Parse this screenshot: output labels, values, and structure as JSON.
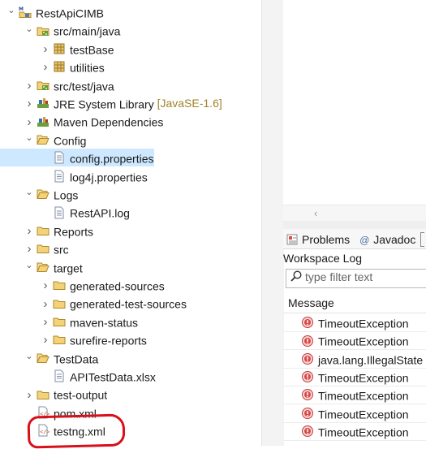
{
  "tree": [
    {
      "label": "RestApiCIMB",
      "twisty": "open",
      "icon": "maven-project-icon",
      "indent": 0
    },
    {
      "label": "src/main/java",
      "twisty": "open",
      "icon": "source-folder-icon",
      "indent": 1
    },
    {
      "label": "testBase",
      "twisty": "closed",
      "icon": "package-icon",
      "indent": 2
    },
    {
      "label": "utilities",
      "twisty": "closed",
      "icon": "package-icon",
      "indent": 2
    },
    {
      "label": "src/test/java",
      "twisty": "closed",
      "icon": "source-folder-icon",
      "indent": 1
    },
    {
      "label": "JRE System Library",
      "decoration": "[JavaSE-1.6]",
      "twisty": "closed",
      "icon": "library-icon",
      "indent": 1
    },
    {
      "label": "Maven Dependencies",
      "twisty": "closed",
      "icon": "library-icon",
      "indent": 1
    },
    {
      "label": "Config",
      "twisty": "open",
      "icon": "folder-open-icon",
      "indent": 1
    },
    {
      "label": "config.properties",
      "twisty": "none",
      "icon": "file-icon",
      "indent": 2,
      "selected": true
    },
    {
      "label": "log4j.properties",
      "twisty": "none",
      "icon": "file-icon",
      "indent": 2
    },
    {
      "label": "Logs",
      "twisty": "open",
      "icon": "folder-open-icon",
      "indent": 1
    },
    {
      "label": "RestAPI.log",
      "twisty": "none",
      "icon": "file-icon",
      "indent": 2
    },
    {
      "label": "Reports",
      "twisty": "closed",
      "icon": "folder-icon",
      "indent": 1
    },
    {
      "label": "src",
      "twisty": "closed",
      "icon": "folder-icon",
      "indent": 1
    },
    {
      "label": "target",
      "twisty": "open",
      "icon": "folder-open-icon",
      "indent": 1
    },
    {
      "label": "generated-sources",
      "twisty": "closed",
      "icon": "folder-icon",
      "indent": 2
    },
    {
      "label": "generated-test-sources",
      "twisty": "closed",
      "icon": "folder-icon",
      "indent": 2
    },
    {
      "label": "maven-status",
      "twisty": "closed",
      "icon": "folder-icon",
      "indent": 2
    },
    {
      "label": "surefire-reports",
      "twisty": "closed",
      "icon": "folder-icon",
      "indent": 2
    },
    {
      "label": "TestData",
      "twisty": "open",
      "icon": "folder-open-icon",
      "indent": 1
    },
    {
      "label": "APITestData.xlsx",
      "twisty": "none",
      "icon": "file-icon",
      "indent": 2
    },
    {
      "label": "test-output",
      "twisty": "closed",
      "icon": "folder-icon",
      "indent": 1
    },
    {
      "label": "pom.xml",
      "twisty": "none",
      "icon": "xml-file-icon",
      "indent": 1
    },
    {
      "label": "testng.xml",
      "twisty": "none",
      "icon": "xml-file-icon",
      "indent": 1
    }
  ],
  "bottom_panel": {
    "tabs": [
      {
        "label": "Problems",
        "icon": "problems-icon"
      },
      {
        "label": "Javadoc",
        "icon": "javadoc-icon"
      }
    ],
    "view_title": "Workspace Log",
    "filter_placeholder": "type filter text",
    "column_header": "Message",
    "rows": [
      "TimeoutException",
      "TimeoutException",
      "java.lang.IllegalState",
      "TimeoutException",
      "TimeoutException",
      "TimeoutException",
      "TimeoutException"
    ]
  },
  "colors": {
    "selection": "#cde8ff",
    "annotation": "#d8101a",
    "folder": "#e8b84a"
  }
}
